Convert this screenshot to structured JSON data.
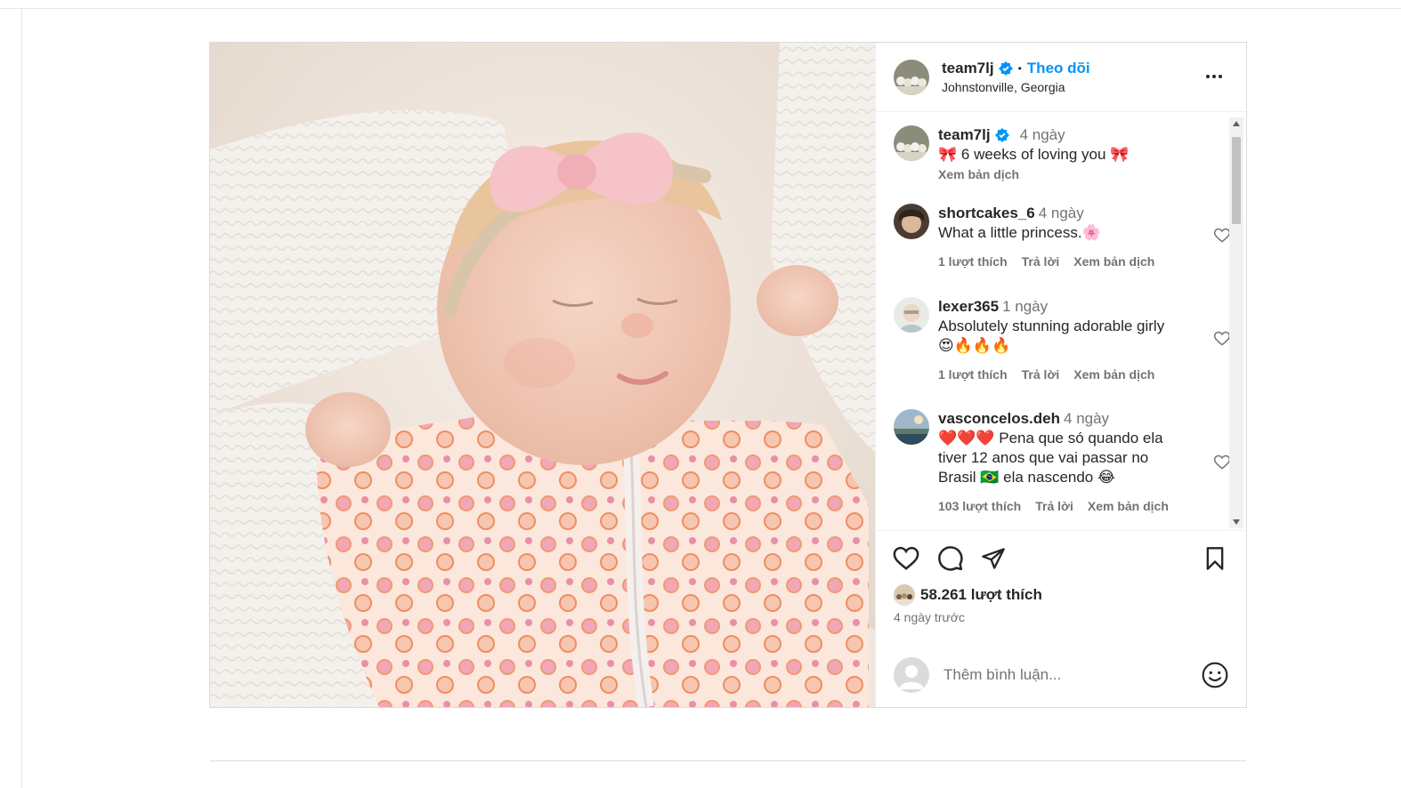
{
  "post": {
    "author": {
      "username": "team7lj",
      "verified_icon": "verified-badge-icon",
      "separator": "•",
      "follow_label": "Theo dõi",
      "location": "Johnstonville, Georgia"
    },
    "caption": {
      "username": "team7lj",
      "time": "4 ngày",
      "text": "🎀 6 weeks of loving you 🎀",
      "translate": "Xem bản dịch"
    },
    "comments": [
      {
        "username": "shortcakes_6",
        "time": "4 ngày",
        "text": "What a little princess.🌸",
        "likes": "1 lượt thích",
        "reply": "Trả lời",
        "translate": "Xem bản dịch"
      },
      {
        "username": "lexer365",
        "time": "1 ngày",
        "text_line1": "Absolutely stunning adorable girly",
        "text_line2": "😍🔥🔥🔥",
        "likes": "1 lượt thích",
        "reply": "Trả lời",
        "translate": "Xem bản dịch"
      },
      {
        "username": "vasconcelos.deh",
        "time": "4 ngày",
        "text_line1": "❤️❤️❤️ Pena que só quando ela",
        "text_line2": "tiver 12 anos que vai passar no",
        "text_line3": "Brasil 🇧🇷 ela nascendo 😂",
        "likes": "103 lượt thích",
        "reply": "Trả lời",
        "translate": "Xem bản dịch"
      }
    ],
    "likes_count": "58.261 lượt thích",
    "posted_ago": "4 ngày trước",
    "add_comment_placeholder": "Thêm bình luận...",
    "icons": [
      "heart-icon",
      "comment-icon",
      "share-icon",
      "bookmark-icon",
      "emoji-icon",
      "more-options-icon"
    ]
  },
  "colors": {
    "link_blue": "#0095f6",
    "text_primary": "#262626",
    "text_secondary": "#737373",
    "border": "#dbdbdb"
  }
}
